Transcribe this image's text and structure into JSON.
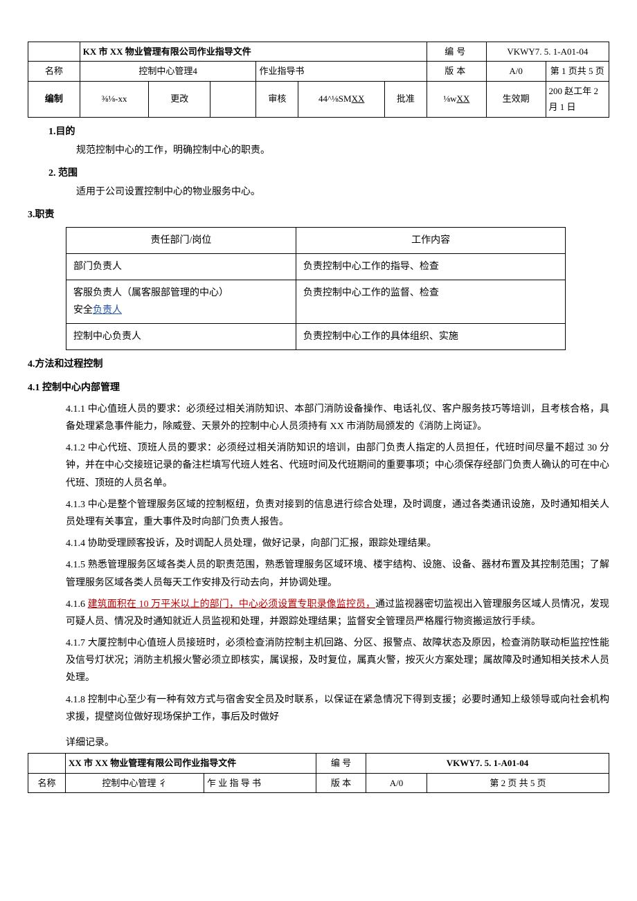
{
  "header1": {
    "companyDoc": "KX 市 XX 物业管理有限公司作业指导文件",
    "labelNo": "编号",
    "docNo": "VKWY7. 5. 1-A01-04",
    "labelName": "名称",
    "docName": "控制中心管理4",
    "typeLabel": "作业指导书",
    "labelVer": "版本",
    "ver": "A/0",
    "pageInfo": "第 1 页共 5 页",
    "labelCompile": "编制",
    "compile": "⅜⅛-xx",
    "labelChange": "更改",
    "changeVal": "",
    "labelReview": "审核",
    "reviewVal": "44^⅛SMXX",
    "labelApprove": "批准",
    "approveVal": "⅛wXX",
    "labelEffective": "生效期",
    "effective": "200 赵工年 2 月 1 日"
  },
  "s1": {
    "title": "1.目的",
    "text": "规范控制中心的工作，明确控制中心的职责。"
  },
  "s2": {
    "title": "2. 范围",
    "text": "适用于公司设置控制中心的物业服务中心。"
  },
  "s3": {
    "title": "3.职责",
    "tableHeader1": "责任部门/岗位",
    "tableHeader2": "工作内容",
    "rows": [
      {
        "dept": "部门负责人",
        "work": "负责控制中心工作的指导、检查"
      },
      {
        "dept_a": "客服负责人（属客服部管理的中心）",
        "dept_b": "安全",
        "dept_c": "负责人",
        "work": "负责控制中心工作的监督、检查"
      },
      {
        "dept": "控制中心负责人",
        "work": "负责控制中心工作的具体组织、实施"
      }
    ]
  },
  "s4": {
    "title": "4.方法和过程控制",
    "sub41": "4.1 控制中心内部管理",
    "p411": "4.1.1 中心值班人员的要求：必须经过相关消防知识、本部门消防设备操作、电话礼仪、客户服务技巧等培训，且考核合格，具备处理紧急事件能力，除威登、天景外的控制中心人员须持有 XX 市消防局颁发的《消防上岗证》。",
    "p412": "4.1.2 中心代班、顶班人员的要求：必须经过相关消防知识的培训，由部门负责人指定的人员担任，代班时间尽量不超过 30 分钟，并在中心交接班记录的备注栏填写代班人姓名、代班时间及代班期间的重要事项；中心须保存经部门负责人确认的可在中心代班、顶班的人员名单。",
    "p413": "4.1.3 中心是整个管理服务区域的控制枢纽，负责对接到的信息进行综合处理，及时调度，通过各类通讯设施，及时通知相关人员处理有关事宜，重大事件及时向部门负责人报告。",
    "p414": "4.1.4 协助受理顾客投诉，及时调配人员处理，做好记录，向部门汇报，跟踪处理结果。",
    "p415": "4.1.5 熟悉管理服务区域各类人员的职责范围，熟悉管理服务区域环境、楼宇结构、设施、设备、器材布置及其控制范围；了解管理服务区域各类人员每天工作安排及行动去向，并协调处理。",
    "p416a": "4.1.6 ",
    "p416link": "建筑面积在 10 万平米以上的部门，中心必须设置专职录像监控员，",
    "p416b": "通过监视器密切监视出入管理服务区域人员情况，发现可疑人员、情况及时通知就近人员监视和处理，并跟踪处理结果；监督安全管理员严格履行物资搬运放行手续。",
    "p417": "4.1.7 大厦控制中心值班人员接班时，必须检查消防控制主机回路、分区、报警点、故障状态及原因，检查消防联动柜监控性能及信号灯状况；消防主机报火警必须立即核实，属误报，及时复位，属真火警，按灭火方案处理；属故障及时通知相关技术人员处理。",
    "p418": "4.1.8 控制中心至少有一种有效方式与宿舍安全员及时联系，以保证在紧急情况下得到支援；必要时通知上级领导或向社会机构求援，提壁岗位做好现场保护工作，事后及时做好",
    "p418b": "详细记录。"
  },
  "header2": {
    "companyDoc": "XX 市 XX 物业管理有限公司作业指导文件",
    "labelNo": "编 号",
    "docNo": "VKWY7. 5. 1-A01-04",
    "labelName": "名称",
    "docName": "控制中心管理 彳",
    "typeLabel": "乍 业 指 导 书",
    "labelVer": "版 本",
    "ver": "A/0",
    "pageInfo": "第 2 页 共 5 页"
  }
}
